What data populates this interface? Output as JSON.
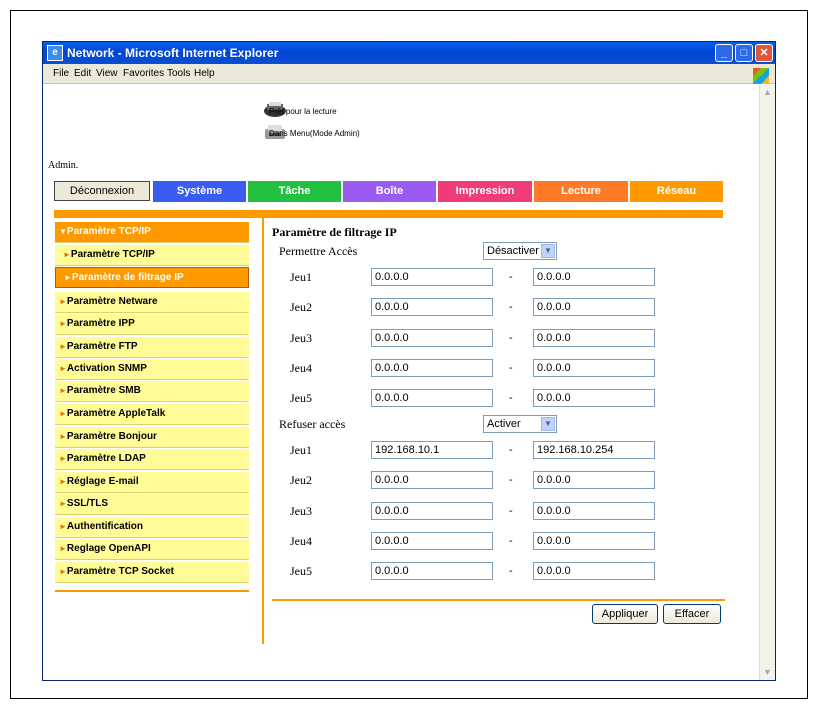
{
  "window": {
    "title": "Network - Microsoft Internet Explorer",
    "minimize": "_",
    "maximize": "□",
    "close": "✕"
  },
  "menu": [
    "File",
    "Edit",
    "View",
    "Favorites",
    "Tools",
    "Help"
  ],
  "status": {
    "line1": "Prêt pour la lecture",
    "line2": "Dans Menu(Mode Admin)"
  },
  "admin_label": "Admin.",
  "logout_label": "Déconnexion",
  "tabs": [
    {
      "label": "Système",
      "color": "#3a5cf0"
    },
    {
      "label": "Tâche",
      "color": "#22c040"
    },
    {
      "label": "Boîte",
      "color": "#9a5cf0"
    },
    {
      "label": "Impression",
      "color": "#f03c78"
    },
    {
      "label": "Lecture",
      "color": "#ff7a28"
    },
    {
      "label": "Réseau",
      "color": "#ff9900"
    }
  ],
  "sidebar": {
    "arrow": "►",
    "arrow_open": "▼",
    "items": [
      "Paramètre TCP/IP",
      "Paramètre TCP/IP",
      "Paramètre de filtrage IP",
      "Paramètre Netware",
      "Paramètre IPP",
      "Paramètre FTP",
      "Activation SNMP",
      "Paramètre SMB",
      "Paramètre AppleTalk",
      "Paramètre Bonjour",
      "Paramètre LDAP",
      "Réglage E-mail",
      "SSL/TLS",
      "Authentification",
      "Reglage OpenAPI",
      "Paramètre TCP Socket"
    ]
  },
  "form": {
    "title": "Paramètre de filtrage IP",
    "dash": "-",
    "permit": {
      "label": "Permettre Accès",
      "select": "Désactiver",
      "rows": [
        {
          "label": "Jeu1",
          "from": "0.0.0.0",
          "to": "0.0.0.0"
        },
        {
          "label": "Jeu2",
          "from": "0.0.0.0",
          "to": "0.0.0.0"
        },
        {
          "label": "Jeu3",
          "from": "0.0.0.0",
          "to": "0.0.0.0"
        },
        {
          "label": "Jeu4",
          "from": "0.0.0.0",
          "to": "0.0.0.0"
        },
        {
          "label": "Jeu5",
          "from": "0.0.0.0",
          "to": "0.0.0.0"
        }
      ]
    },
    "deny": {
      "label": "Refuser accès",
      "select": "Activer",
      "rows": [
        {
          "label": "Jeu1",
          "from": "192.168.10.1",
          "to": "192.168.10.254"
        },
        {
          "label": "Jeu2",
          "from": "0.0.0.0",
          "to": "0.0.0.0"
        },
        {
          "label": "Jeu3",
          "from": "0.0.0.0",
          "to": "0.0.0.0"
        },
        {
          "label": "Jeu4",
          "from": "0.0.0.0",
          "to": "0.0.0.0"
        },
        {
          "label": "Jeu5",
          "from": "0.0.0.0",
          "to": "0.0.0.0"
        }
      ]
    },
    "apply": "Appliquer",
    "clear": "Effacer"
  }
}
